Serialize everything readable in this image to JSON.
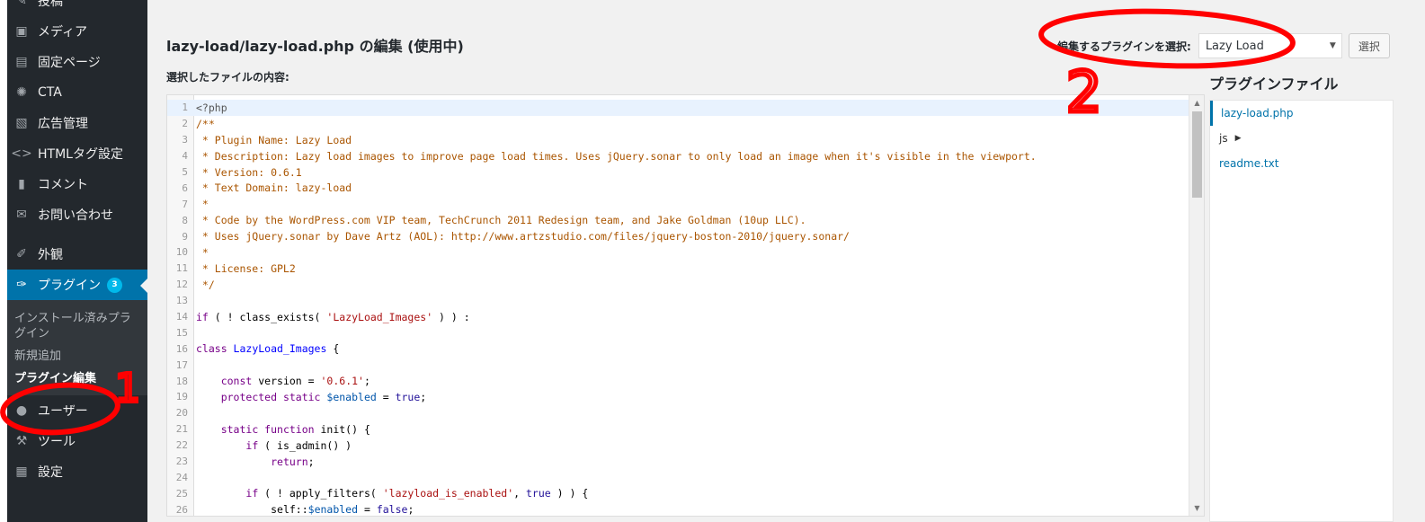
{
  "sidebar": {
    "items": [
      {
        "label": "投稿",
        "icon": "pin-icon"
      },
      {
        "label": "メディア",
        "icon": "media-icon"
      },
      {
        "label": "固定ページ",
        "icon": "page-icon"
      },
      {
        "label": "CTA",
        "icon": "cta-icon"
      },
      {
        "label": "広告管理",
        "icon": "ad-icon"
      },
      {
        "label": "HTMLタグ設定",
        "icon": "code-icon"
      },
      {
        "label": "コメント",
        "icon": "comment-icon"
      },
      {
        "label": "お問い合わせ",
        "icon": "mail-icon"
      }
    ],
    "appearance": "外観",
    "plugins": {
      "label": "プラグイン",
      "badge": "3"
    },
    "plugin_submenu": [
      "インストール済みプラグイン",
      "新規追加",
      "プラグイン編集"
    ],
    "after": [
      {
        "label": "ユーザー",
        "icon": "user-icon"
      },
      {
        "label": "ツール",
        "icon": "tools-icon"
      },
      {
        "label": "設定",
        "icon": "settings-icon"
      }
    ]
  },
  "header": {
    "title": "lazy-load/lazy-load.php の編集 (使用中)",
    "file_label": "選択したファイルの内容:",
    "select_label": "編集するプラグインを選択:",
    "select_value": "Lazy Load",
    "select_button": "選択"
  },
  "plugin_files": {
    "heading": "プラグインファイル",
    "files": [
      "lazy-load.php",
      "js",
      "readme.txt"
    ]
  },
  "annotations": [
    "1",
    "2"
  ],
  "colors": {
    "accent": "#0073aa",
    "sidebar": "#23282d",
    "annotation": "#ff0000"
  },
  "code": {
    "line_numbers": [
      "1",
      "2",
      "3",
      "4",
      "5",
      "6",
      "7",
      "8",
      "9",
      "10",
      "11",
      "12",
      "13",
      "14",
      "15",
      "16",
      "17",
      "18",
      "19",
      "20",
      "21",
      "22",
      "23",
      "24",
      "25",
      "26"
    ],
    "l1": "<?php",
    "l2": "/**",
    "l3": " * Plugin Name: Lazy Load",
    "l4": " * Description: Lazy load images to improve page load times. Uses jQuery.sonar to only load an image when it's visible in the viewport.",
    "l5": " * Version: 0.6.1",
    "l6": " * Text Domain: lazy-load",
    "l7": " *",
    "l8": " * Code by the WordPress.com VIP team, TechCrunch 2011 Redesign team, and Jake Goldman (10up LLC).",
    "l9": " * Uses jQuery.sonar by Dave Artz (AOL): http://www.artzstudio.com/files/jquery-boston-2010/jquery.sonar/",
    "l10": " *",
    "l11": " * License: GPL2",
    "l12": " */",
    "l14_kw": "if",
    "l14_a": " ( ! class_exists( ",
    "l14_s": "'LazyLoad_Images'",
    "l14_b": " ) ) :",
    "l16_kw": "class",
    "l16_name": " LazyLoad_Images",
    "l16_b": " {",
    "l18_kw": "const",
    "l18_a": " version = ",
    "l18_s": "'0.6.1'",
    "l18_b": ";",
    "l19_kw": "protected static",
    "l19_v": " $enabled",
    "l19_a": " = ",
    "l19_t": "true",
    "l19_b": ";",
    "l21_kw": "static function",
    "l21_a": " init() {",
    "l22_kw": "if",
    "l22_a": " ( is_admin() )",
    "l23_kw": "return",
    "l23_a": ";",
    "l25_kw": "if",
    "l25_a": " ( ! apply_filters( ",
    "l25_s": "'lazyload_is_enabled'",
    "l25_c": ", ",
    "l25_t": "true",
    "l25_b": " ) ) {",
    "l26_a": "self::",
    "l26_v": "$enabled",
    "l26_b": " = ",
    "l26_t": "false",
    "l26_c": ";"
  }
}
